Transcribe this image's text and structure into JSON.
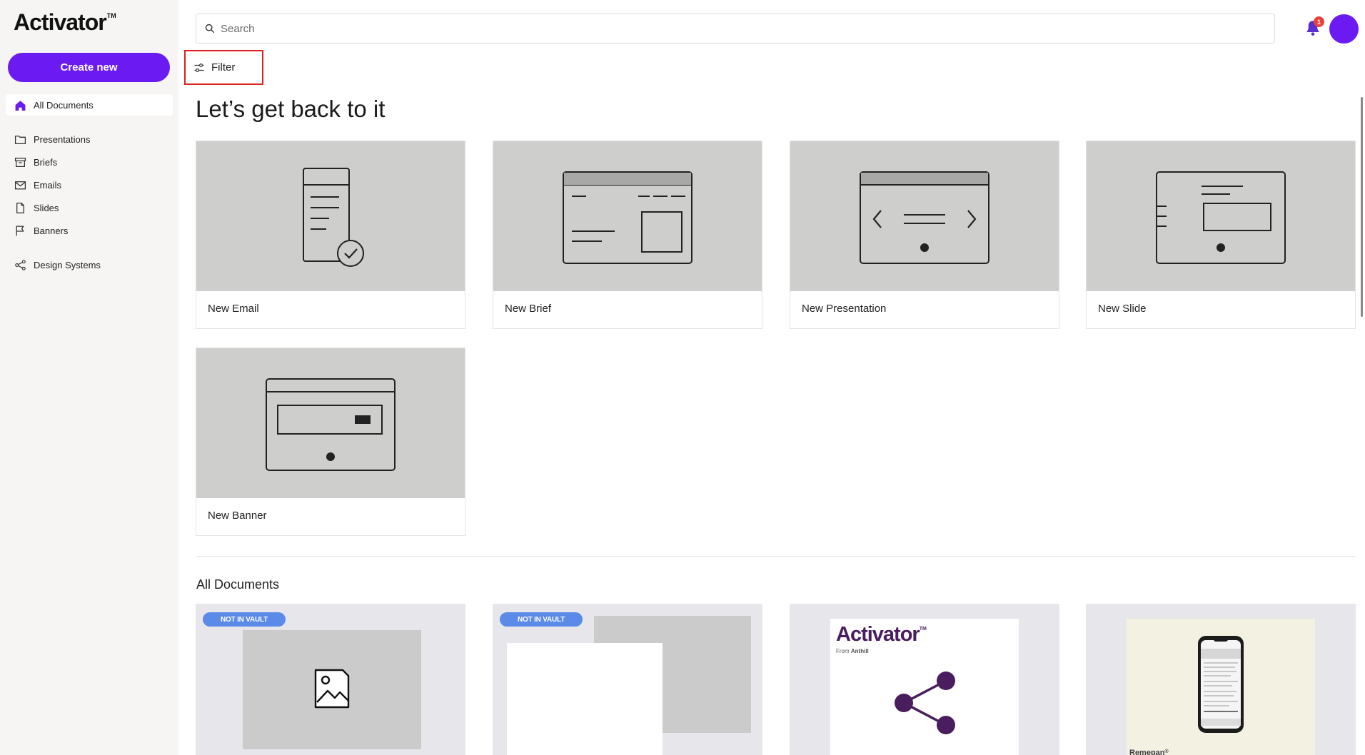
{
  "brand": {
    "name": "Activator",
    "tm": "TM"
  },
  "sidebar": {
    "create_label": "Create new",
    "items": [
      {
        "label": "All Documents",
        "icon": "home-icon"
      },
      {
        "label": "Presentations",
        "icon": "folder-icon"
      },
      {
        "label": "Briefs",
        "icon": "archive-icon"
      },
      {
        "label": "Emails",
        "icon": "mail-icon"
      },
      {
        "label": "Slides",
        "icon": "file-icon"
      },
      {
        "label": "Banners",
        "icon": "flag-icon"
      },
      {
        "label": "Design Systems",
        "icon": "share-icon"
      }
    ]
  },
  "header": {
    "search_placeholder": "Search",
    "notification_count": "1",
    "filter_label": "Filter"
  },
  "main": {
    "heading": "Let’s get back to it",
    "templates": [
      {
        "label": "New Email",
        "icon": "email-template-icon"
      },
      {
        "label": "New Brief",
        "icon": "brief-template-icon"
      },
      {
        "label": "New Presentation",
        "icon": "presentation-template-icon"
      },
      {
        "label": "New Slide",
        "icon": "slide-template-icon"
      },
      {
        "label": "New Banner",
        "icon": "banner-template-icon"
      }
    ],
    "documents_title": "All Documents",
    "documents": [
      {
        "badge": "NOT IN VAULT",
        "icon": "image-placeholder-icon"
      },
      {
        "badge": "NOT IN VAULT"
      },
      {
        "thumb_title": "Activator",
        "thumb_tm": "TM",
        "thumb_from": "From ",
        "thumb_from_brand": "Anthill",
        "icon": "share-icon"
      },
      {
        "thumb_brand": "Remepan",
        "thumb_brand_mark": "®",
        "icon": "phone-icon"
      }
    ]
  },
  "colors": {
    "accent": "#6b1bf2",
    "badge": "#5b8ae8",
    "notification": "#e8413c",
    "highlight_border": "#e02020",
    "share_graphic": "#4a1d5e"
  }
}
